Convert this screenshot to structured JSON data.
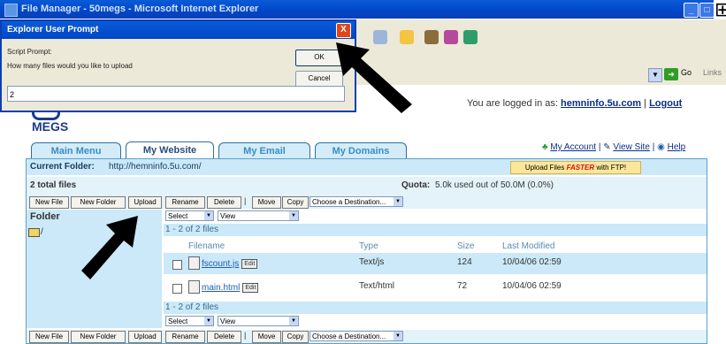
{
  "window": {
    "title": "File Manager - 50megs - Microsoft Internet Explorer",
    "min_label": "_",
    "max_label": "□"
  },
  "address_bar": {
    "go_label": "Go",
    "links_label": "Links"
  },
  "prompt": {
    "title": "Explorer User Prompt",
    "close_label": "X",
    "script_label": "Script Prompt:",
    "question": "How many files would you like to upload",
    "ok_label": "OK",
    "cancel_label": "Cancel",
    "input_value": "2"
  },
  "site": {
    "logo_text": "MEGS",
    "login_prefix": "You are logged in as:",
    "login_user": "hemninfo.5u.com",
    "login_sep": "|",
    "logout_label": "Logout",
    "tabs": [
      "Main Menu",
      "My Website",
      "My Email",
      "My Domains"
    ],
    "active_tab": "My Website",
    "account_links": {
      "my_account": "My Account",
      "sep": "|",
      "view_site": "View Site",
      "help": "Help"
    }
  },
  "panel": {
    "current_folder_label": "Current Folder:",
    "current_folder_url": "http://hemninfo.5u.com/",
    "ftp_prefix": "Upload Files",
    "ftp_emph": "FASTER",
    "ftp_suffix": "with FTP!",
    "total_files": "2 total files",
    "quota_label": "Quota:",
    "quota_text": "5.0k used out of 50.0M (0.0%)",
    "buttons": [
      "New File",
      "New Folder",
      "Upload",
      "Rename",
      "Delete",
      "Move",
      "Copy"
    ],
    "sep": "|",
    "destination_placeholder": "Choose a Destination...",
    "folder_header": "Folder",
    "folder_root": "/",
    "select_label": "Select",
    "view_label": "View",
    "range_text": "1 - 2 of 2 files",
    "columns": [
      "Filename",
      "Type",
      "Size",
      "Last Modified"
    ],
    "files": [
      {
        "name": "fscount.js",
        "type": "Text/js",
        "size": "124",
        "modified": "10/04/06 02:59"
      },
      {
        "name": "main.html",
        "type": "Text/html",
        "size": "72",
        "modified": "10/04/06 02:59"
      }
    ],
    "edit_label": "Edit",
    "dd_glyph": "▼"
  }
}
